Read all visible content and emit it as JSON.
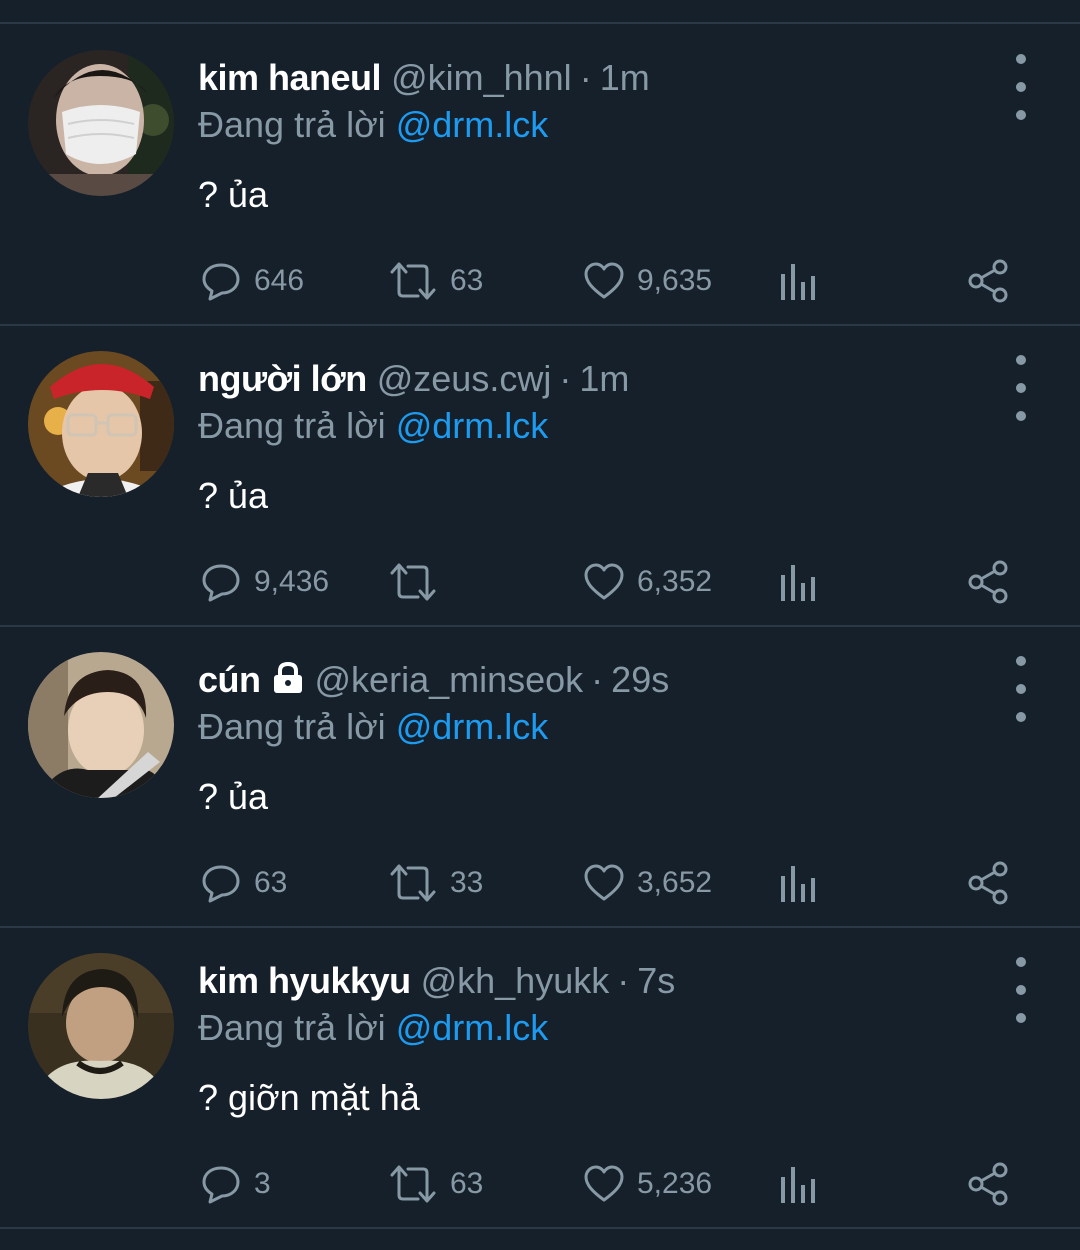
{
  "reply_prefix": "Đang trả lời",
  "colors": {
    "background": "#15202b",
    "muted": "#8899a6",
    "link": "#1d9bf0",
    "divider": "#2b3846"
  },
  "tweets": [
    {
      "name": "kim haneul",
      "locked": false,
      "handle": "@kim_hhnl",
      "time": "1m",
      "reply_to": "@drm.lck",
      "text": "? ủa",
      "replies": "646",
      "retweets": "63",
      "likes": "9,635"
    },
    {
      "name": "người lớn",
      "locked": false,
      "handle": "@zeus.cwj",
      "time": "1m",
      "reply_to": "@drm.lck",
      "text": "? ủa",
      "replies": "9,436",
      "retweets": "",
      "likes": "6,352"
    },
    {
      "name": "cún",
      "locked": true,
      "handle": "@keria_minseok",
      "time": "29s",
      "reply_to": "@drm.lck",
      "text": "? ủa",
      "replies": "63",
      "retweets": "33",
      "likes": "3,652"
    },
    {
      "name": "kim hyukkyu",
      "locked": false,
      "handle": "@kh_hyukk",
      "time": "7s",
      "reply_to": "@drm.lck",
      "text": "? giỡn mặt hả",
      "replies": "3",
      "retweets": "63",
      "likes": "5,236"
    }
  ]
}
